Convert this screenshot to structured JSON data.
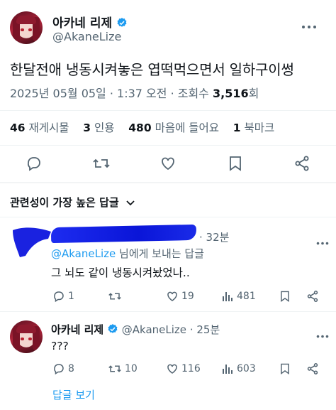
{
  "tweet": {
    "author_name": "아카네 리제",
    "author_handle": "@AkaneLize",
    "text": "한달전애 냉동시켜놓은 엽떡먹으면서 일하구이썽",
    "time": "2025년 05월 05일 · 1:37 오전 · 조회수",
    "views": "3,516",
    "views_suffix": "회"
  },
  "stats": {
    "reposts_count": "46",
    "reposts_label": "재게시물",
    "quotes_count": "3",
    "quotes_label": "인용",
    "likes_count": "480",
    "likes_label": "마음에 들어요",
    "bookmarks_count": "1",
    "bookmarks_label": "북마크"
  },
  "sort": {
    "label": "관련성이 가장 높은 답글"
  },
  "reply1": {
    "time": "· 32분",
    "mention": "@AkaneLize",
    "mention_suffix": " 님에게 보내는 답글",
    "text": "그 뇌도 같이 냉동시켜놨었나..",
    "replies": "1",
    "reposts": "",
    "likes": "19",
    "views": "481"
  },
  "reply2": {
    "author_name": "아카네 리제",
    "author_handle": "@AkaneLize",
    "time": "· 25분",
    "text": "???",
    "replies": "8",
    "reposts": "10",
    "likes": "116",
    "views": "603",
    "show_replies": "답글 보기"
  },
  "colors": {
    "accent": "#1d9bf0",
    "muted": "#536471",
    "text": "#0f1419"
  },
  "icons": [
    "verified-badge-icon",
    "reply-icon",
    "repost-icon",
    "like-icon",
    "bookmark-icon",
    "share-icon",
    "views-icon",
    "chevron-down-icon",
    "more-icon"
  ]
}
